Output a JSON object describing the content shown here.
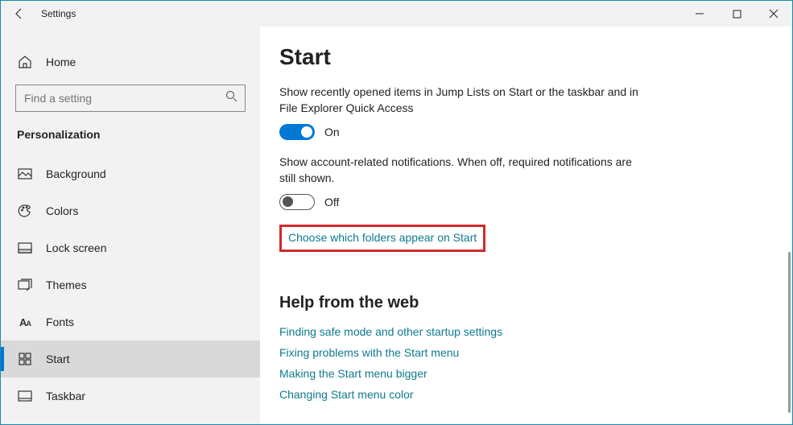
{
  "titlebar": {
    "title": "Settings"
  },
  "sidebar": {
    "home": "Home",
    "search_placeholder": "Find a setting",
    "category": "Personalization",
    "items": [
      {
        "label": "Background"
      },
      {
        "label": "Colors"
      },
      {
        "label": "Lock screen"
      },
      {
        "label": "Themes"
      },
      {
        "label": "Fonts"
      },
      {
        "label": "Start"
      },
      {
        "label": "Taskbar"
      }
    ]
  },
  "main": {
    "title": "Start",
    "setting1": {
      "desc": "Show recently opened items in Jump Lists on Start or the taskbar and in File Explorer Quick Access",
      "state": "On"
    },
    "setting2": {
      "desc": "Show account-related notifications. When off, required notifications are still shown.",
      "state": "Off"
    },
    "folders_link": "Choose which folders appear on Start",
    "help_heading": "Help from the web",
    "help_links": [
      "Finding safe mode and other startup settings",
      "Fixing problems with the Start menu",
      "Making the Start menu bigger",
      "Changing Start menu color"
    ]
  }
}
